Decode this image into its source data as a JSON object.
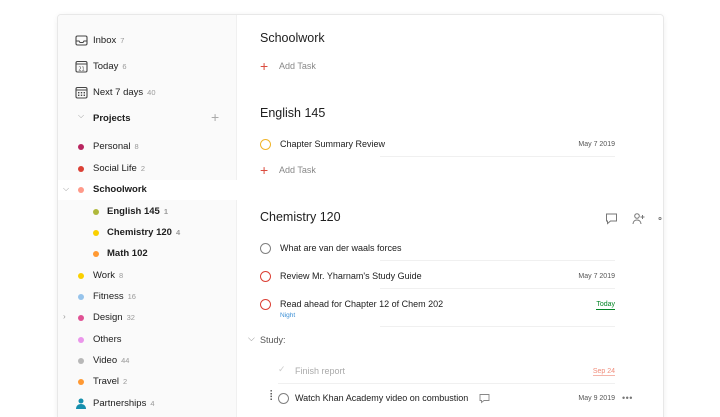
{
  "sidebar": {
    "filters": [
      {
        "label": "Inbox",
        "count": "7",
        "icon": "inbox-icon"
      },
      {
        "label": "Today",
        "count": "6",
        "icon": "calendar-today-icon",
        "day": "21"
      },
      {
        "label": "Next 7 days",
        "count": "40",
        "icon": "calendar-week-icon"
      }
    ],
    "projects_title": "Projects",
    "projects": [
      {
        "label": "Personal",
        "count": "8",
        "color": "#b8255f"
      },
      {
        "label": "Social Life",
        "count": "2",
        "color": "#db4035"
      },
      {
        "label": "Schoolwork",
        "count": "",
        "color": "#ff9a8a"
      },
      {
        "label": "English 145",
        "count": "1",
        "color": "#afb83b"
      },
      {
        "label": "Chemistry 120",
        "count": "4",
        "color": "#fad000"
      },
      {
        "label": "Math 102",
        "count": "",
        "color": "#ff9933"
      },
      {
        "label": "Work",
        "count": "8",
        "color": "#fad000"
      },
      {
        "label": "Fitness",
        "count": "16",
        "color": "#96c3eb"
      },
      {
        "label": "Design",
        "count": "32",
        "color": "#e05194"
      },
      {
        "label": "Others",
        "count": "",
        "color": "#eb96eb"
      },
      {
        "label": "Video",
        "count": "44",
        "color": "#b8b8b8"
      },
      {
        "label": "Travel",
        "count": "2",
        "color": "#ff9933"
      },
      {
        "label": "Partnerships",
        "count": "4",
        "color": "#158fad"
      }
    ]
  },
  "main": {
    "sections": [
      {
        "title": "Schoolwork",
        "add_label": "Add Task"
      },
      {
        "title": "English 145",
        "add_label": "Add Task"
      },
      {
        "title": "Chemistry 120"
      }
    ],
    "english_tasks": [
      {
        "text": "Chapter Summary Review",
        "date": "May 7 2019",
        "priority_color": "#f0b429"
      }
    ],
    "chem_tasks": [
      {
        "text": "What are van der waals forces",
        "date": "",
        "priority_color": "#808080"
      },
      {
        "text": "Review Mr. Yharnam's Study Guide",
        "date": "May 7 2019",
        "priority_color": "#db4035"
      },
      {
        "text": "Read ahead for Chapter 12 of Chem 202",
        "date": "Today",
        "sub": "Night",
        "priority_color": "#db4035"
      }
    ],
    "subsection": "Study:",
    "study_tasks": [
      {
        "text": "Finish report",
        "date": "Sep 24",
        "completed": true
      },
      {
        "text": "Watch Khan Academy video on combustion",
        "date": "May 9 2019",
        "completed": false
      }
    ]
  }
}
